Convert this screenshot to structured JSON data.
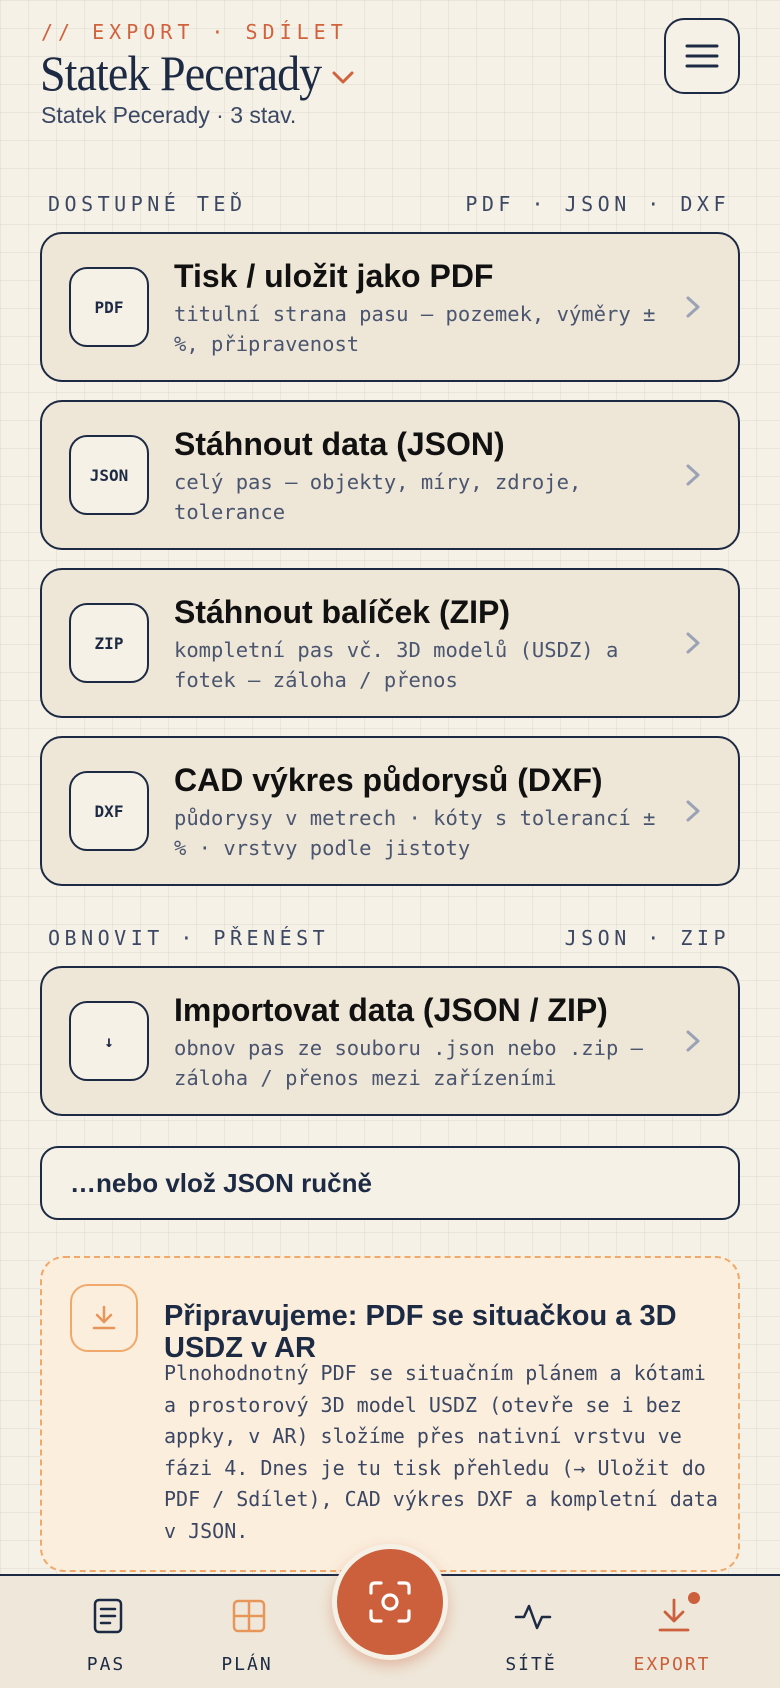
{
  "header": {
    "eyebrow": "// EXPORT · SDÍLET",
    "title": "Statek Pecerady",
    "subtitle": "Statek Pecerady · 3 stav."
  },
  "sections": {
    "available": {
      "label": "DOSTUPNÉ TEĎ",
      "formats": "PDF · JSON · DXF"
    },
    "restore": {
      "label": "OBNOVIT · PŘENÉST",
      "formats": "JSON · ZIP"
    }
  },
  "cards": [
    {
      "badge": "PDF",
      "title": "Tisk / uložit jako PDF",
      "desc": "titulní strana pasu — pozemek, výměry ±%, připravenost"
    },
    {
      "badge": "JSON",
      "title": "Stáhnout data (JSON)",
      "desc": "celý pas — objekty, míry, zdroje, tolerance"
    },
    {
      "badge": "ZIP",
      "title": "Stáhnout balíček (ZIP)",
      "desc": "kompletní pas vč. 3D modelů (USDZ) a fotek — záloha / přenos"
    },
    {
      "badge": "DXF",
      "title": "CAD výkres půdorysů (DXF)",
      "desc": "půdorysy v metrech · kóty s tolerancí ±% · vrstvy podle jistoty"
    }
  ],
  "import_card": {
    "badge": "↓",
    "title": "Importovat data (JSON / ZIP)",
    "desc": "obnov pas ze souboru .json nebo .zip — záloha / přenos mezi zařízeními"
  },
  "paste_label": "…nebo vlož JSON ručně",
  "notice": {
    "title": "Připravujeme: PDF se situačkou a 3D USDZ v AR",
    "body": "Plnohodnotný PDF se situačním plánem a kótami a prostorový 3D model USDZ (otevře se i bez appky, v AR) složíme přes nativní vrstvu ve fázi 4. Dnes je tu tisk přehledu (→ Uložit do PDF / Sdílet), CAD výkres DXF a kompletní data v JSON."
  },
  "nav": {
    "items": [
      {
        "label": "PAS",
        "icon": "document-icon"
      },
      {
        "label": "PLÁN",
        "icon": "grid-plan-icon"
      },
      {
        "label": "SÍTĚ",
        "icon": "activity-icon"
      },
      {
        "label": "EXPORT",
        "icon": "download-icon"
      }
    ],
    "scan_icon": "scan-icon",
    "active": "EXPORT"
  },
  "colors": {
    "accent": "#cc5f3c",
    "ink": "#1d2a44",
    "paper": "#f6f1e6",
    "card": "#eee6d6",
    "notice_border": "#f0a96a"
  }
}
